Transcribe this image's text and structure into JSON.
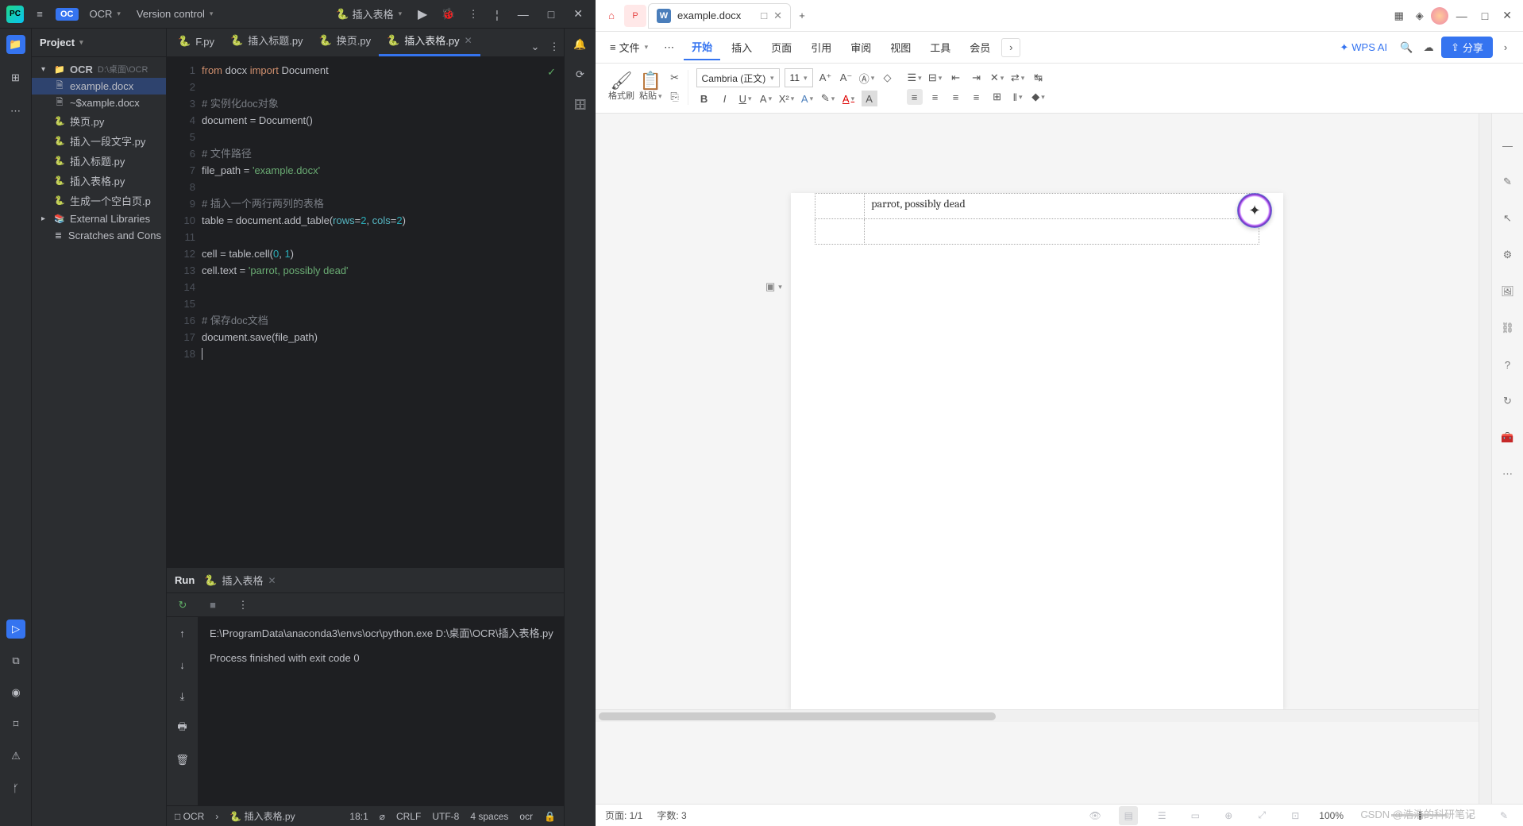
{
  "ide": {
    "project_name": "OCR",
    "vcs_label": "Version control",
    "run_config": "插入表格",
    "sidebar": {
      "header": "Project",
      "root_name": "OCR",
      "root_path": "D:\\桌面\\OCR",
      "files": [
        {
          "name": "example.docx",
          "icon": "docx",
          "selected": true
        },
        {
          "name": "~$xample.docx",
          "icon": "docx"
        },
        {
          "name": "换页.py",
          "icon": "py"
        },
        {
          "name": "插入一段文字.py",
          "icon": "py"
        },
        {
          "name": "插入标题.py",
          "icon": "py"
        },
        {
          "name": "插入表格.py",
          "icon": "py"
        },
        {
          "name": "生成一个空白页.p",
          "icon": "py"
        }
      ],
      "ext_libs": "External Libraries",
      "scratches": "Scratches and Cons"
    },
    "tabs": [
      {
        "label": "F.py"
      },
      {
        "label": "插入标题.py"
      },
      {
        "label": "换页.py"
      },
      {
        "label": "插入表格.py",
        "active": true
      }
    ],
    "code_lines": [
      {
        "n": 1
      },
      {
        "n": 2
      },
      {
        "n": 3
      },
      {
        "n": 4
      },
      {
        "n": 5
      },
      {
        "n": 6
      },
      {
        "n": 7
      },
      {
        "n": 8
      },
      {
        "n": 9
      },
      {
        "n": 10
      },
      {
        "n": 11
      },
      {
        "n": 12
      },
      {
        "n": 13
      },
      {
        "n": 14
      },
      {
        "n": 15
      },
      {
        "n": 16
      },
      {
        "n": 17
      },
      {
        "n": 18
      }
    ],
    "code": {
      "l1_kw1": "from",
      "l1_mod": "docx",
      "l1_kw2": "import",
      "l1_cls": "Document",
      "l3": "# 实例化doc对象",
      "l4": "document = Document()",
      "l6": "# 文件路径",
      "l7a": "file_path = ",
      "l7b": "'example.docx'",
      "l9": "# 插入一个两行两列的表格",
      "l10a": "table = document.add_table(",
      "l10rows": "rows",
      "l10e": "=",
      "l10n1": "2",
      "l10c": ", ",
      "l10cols": "cols",
      "l10n2": "2",
      "l10end": ")",
      "l12a": "cell = table.cell(",
      "l12n0": "0",
      "l12c": ", ",
      "l12n1": "1",
      "l12end": ")",
      "l13a": "cell.text = ",
      "l13s": "'parrot, possibly dead'",
      "l16": "# 保存doc文档",
      "l17": "document.save(file_path)"
    },
    "run": {
      "label": "Run",
      "file": "插入表格",
      "output_l1": "E:\\ProgramData\\anaconda3\\envs\\ocr\\python.exe D:\\桌面\\OCR\\插入表格.py",
      "output_l2": "Process finished with exit code 0"
    },
    "status": {
      "breadcrumb1": "OCR",
      "breadcrumb2": "插入表格.py",
      "pos": "18:1",
      "crlf": "CRLF",
      "enc": "UTF-8",
      "indent": "4 spaces",
      "env": "ocr"
    }
  },
  "wps": {
    "tab_title": "example.docx",
    "file_menu": "文件",
    "menu": [
      "开始",
      "插入",
      "页面",
      "引用",
      "审阅",
      "视图",
      "工具",
      "会员"
    ],
    "active_menu": 0,
    "wps_ai": "WPS AI",
    "share": "分享",
    "paste": "粘贴",
    "format_brush": "格式刷",
    "font": "Cambria (正文)",
    "font_size": "11",
    "table_cell_text": "parrot, possibly dead",
    "status": {
      "page": "页面: 1/1",
      "words": "字数: 3",
      "zoom": "100%"
    },
    "watermark": "CSDN @浩浩的科研笔记"
  }
}
